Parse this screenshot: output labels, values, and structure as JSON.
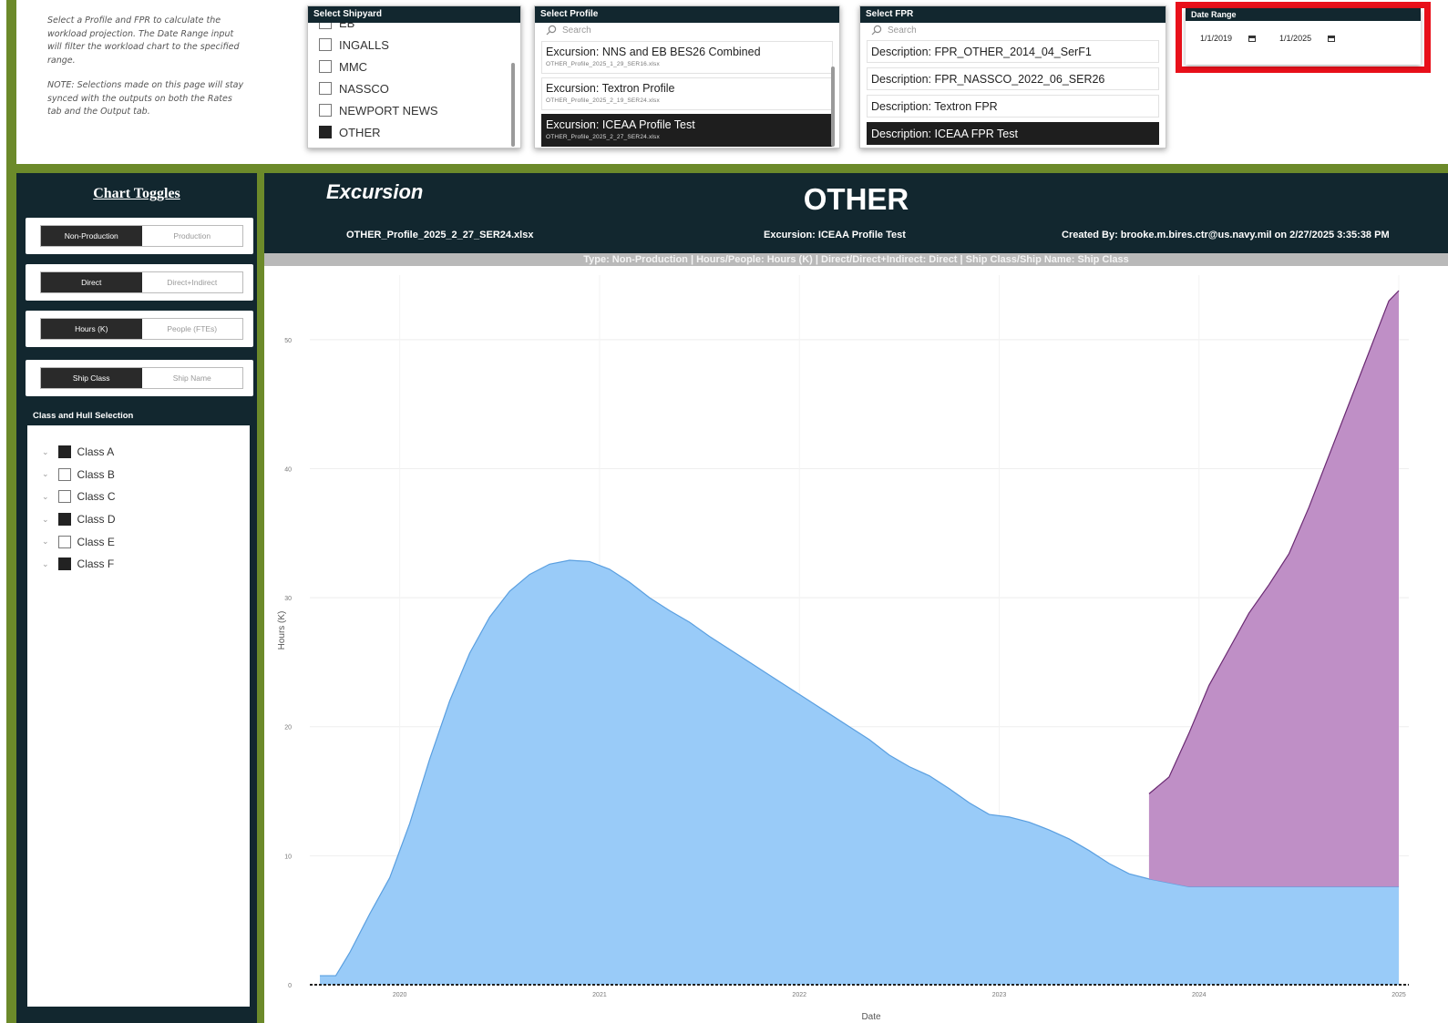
{
  "instructions": {
    "line1": "Select a Profile and FPR to calculate the workload projection. The Date Range input will filter the workload chart to the specified range.",
    "line2": "NOTE: Selections made on this page will stay synced with the outputs on both the Rates tab and the Output tab."
  },
  "shipyard": {
    "header": "Select Shipyard",
    "items": [
      {
        "label": "EB",
        "checked": false
      },
      {
        "label": "INGALLS",
        "checked": false
      },
      {
        "label": "MMC",
        "checked": false
      },
      {
        "label": "NASSCO",
        "checked": false
      },
      {
        "label": "NEWPORT NEWS",
        "checked": false
      },
      {
        "label": "OTHER",
        "checked": true
      }
    ]
  },
  "profile": {
    "header": "Select Profile",
    "search_placeholder": "Search",
    "items": [
      {
        "title": "Excursion: NNS and EB BES26 Combined",
        "file": "OTHER_Profile_2025_1_29_SER16.xlsx",
        "selected": false
      },
      {
        "title": "Excursion: Textron Profile",
        "file": "OTHER_Profile_2025_2_19_SER24.xlsx",
        "selected": false
      },
      {
        "title": "Excursion: ICEAA Profile Test",
        "file": "OTHER_Profile_2025_2_27_SER24.xlsx",
        "selected": true
      }
    ]
  },
  "fpr": {
    "header": "Select FPR",
    "search_placeholder": "Search",
    "items": [
      {
        "label": "Description: FPR_OTHER_2014_04_SerF1",
        "selected": false
      },
      {
        "label": "Description: FPR_NASSCO_2022_06_SER26",
        "selected": false
      },
      {
        "label": "Description: Textron FPR",
        "selected": false
      },
      {
        "label": "Description: ICEAA FPR Test",
        "selected": true
      }
    ]
  },
  "date_range": {
    "header": "Date Range",
    "start": "1/1/2019",
    "end": "1/1/2025"
  },
  "toggles": {
    "title": "Chart Toggles",
    "items": [
      {
        "left": "Non-Production",
        "right": "Production",
        "active": "left"
      },
      {
        "left": "Direct",
        "right": "Direct+Indirect",
        "active": "left"
      },
      {
        "left": "Hours (K)",
        "right": "People (FTEs)",
        "active": "left"
      },
      {
        "left": "Ship Class",
        "right": "Ship Name",
        "active": "left"
      }
    ]
  },
  "hull": {
    "header": "Class and Hull Selection",
    "items": [
      {
        "label": "Class A",
        "checked": true
      },
      {
        "label": "Class B",
        "checked": false
      },
      {
        "label": "Class C",
        "checked": false
      },
      {
        "label": "Class D",
        "checked": true
      },
      {
        "label": "Class E",
        "checked": false
      },
      {
        "label": "Class F",
        "checked": true
      }
    ]
  },
  "chart_header": {
    "subtitle": "Excursion",
    "title": "OTHER",
    "file": "OTHER_Profile_2025_2_27_SER24.xlsx",
    "excursion": "Excursion: ICEAA Profile Test",
    "created": "Created By: brooke.m.bires.ctr@us.navy.mil on 2/27/2025 3:35:38 PM",
    "banner": "Type: Non-Production | Hours/People: Hours (K) | Direct/Direct+Indirect: Direct | Ship Class/Ship Name: Ship Class"
  },
  "colors": {
    "navy": "#12272f",
    "green": "#6c8a2a",
    "highlight_red": "#e8101a",
    "series_a": "#99cbf8",
    "series_a_line": "#5a9fe0",
    "series_b": "#bf8fc6",
    "series_b_line": "#6a2a72"
  },
  "chart_data": {
    "type": "area",
    "xlabel": "Date",
    "ylabel": "Hours (K)",
    "ylim": [
      0,
      55
    ],
    "yticks": [
      0,
      10,
      20,
      30,
      40,
      50
    ],
    "xticks": [
      2020,
      2021,
      2022,
      2023,
      2024,
      2025
    ],
    "xlim": [
      2019.55,
      2025.05
    ],
    "grid": true,
    "legend": "none",
    "stacked": true,
    "series": [
      {
        "x": [
          2019.6,
          2019.68,
          2019.75,
          2019.85,
          2019.95,
          2020.05,
          2020.15,
          2020.25,
          2020.35,
          2020.45,
          2020.55,
          2020.65,
          2020.75,
          2020.85,
          2020.95,
          2021.05,
          2021.15,
          2021.25,
          2021.35,
          2021.45,
          2021.55,
          2021.65,
          2021.75,
          2021.85,
          2021.95,
          2022.05,
          2022.15,
          2022.25,
          2022.35,
          2022.45,
          2022.55,
          2022.65,
          2022.75,
          2022.85,
          2022.95,
          2023.05,
          2023.15,
          2023.25,
          2023.35,
          2023.45,
          2023.55,
          2023.65,
          2023.75,
          2023.85,
          2023.95,
          2024.05,
          2024.15,
          2024.25,
          2024.35,
          2024.45,
          2024.55,
          2024.65,
          2024.75,
          2024.85,
          2024.95,
          2025.0
        ],
        "values": [
          0.7,
          0.7,
          2.5,
          5.5,
          8.3,
          12.5,
          17.5,
          22.0,
          25.7,
          28.5,
          30.5,
          31.8,
          32.6,
          32.9,
          32.8,
          32.2,
          31.2,
          30.0,
          29.0,
          28.1,
          27.0,
          26.0,
          25.0,
          24.0,
          23.0,
          22.0,
          21.0,
          20.0,
          19.0,
          17.8,
          16.9,
          16.2,
          15.2,
          14.1,
          13.2,
          13.0,
          12.6,
          12.0,
          11.3,
          10.4,
          9.4,
          8.6,
          8.2,
          7.9,
          7.6,
          7.6,
          7.6,
          7.6,
          7.6,
          7.6,
          7.6,
          7.6,
          7.6,
          7.6,
          7.6,
          7.6
        ]
      },
      {
        "x": [
          2023.75,
          2023.85,
          2023.95,
          2024.05,
          2024.15,
          2024.25,
          2024.35,
          2024.45,
          2024.55,
          2024.65,
          2024.75,
          2024.85,
          2024.95,
          2025.0
        ],
        "values": [
          14.8,
          16.1,
          19.5,
          23.2,
          26.0,
          28.8,
          31.0,
          33.4,
          37.0,
          41.0,
          45.0,
          49.0,
          53.0,
          53.8
        ]
      }
    ]
  }
}
